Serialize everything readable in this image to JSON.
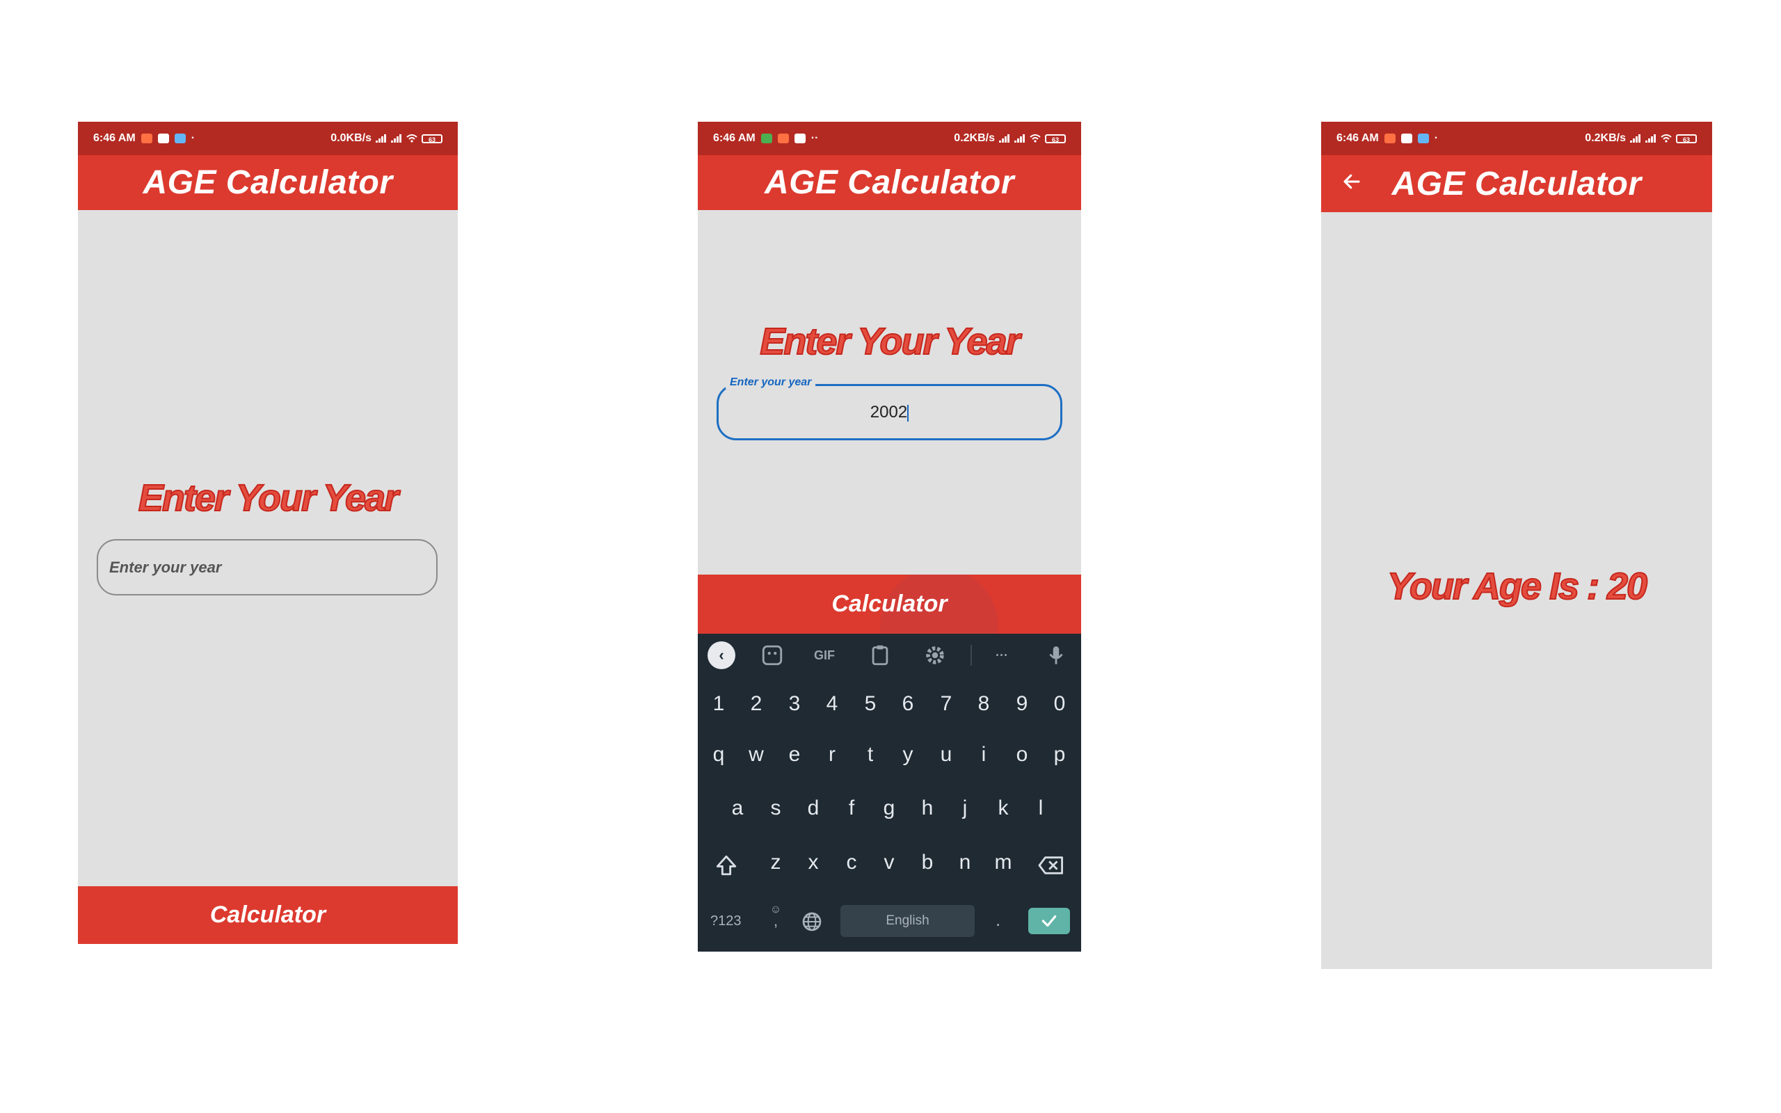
{
  "status": {
    "time": "6:46 AM",
    "dot": "·",
    "dots2": "··",
    "speed_1": "0.0KB/s",
    "speed_2": "0.2KB/s",
    "speed_3": "0.2KB/s",
    "battery": "63"
  },
  "app": {
    "title": "AGE Calculator"
  },
  "screen1": {
    "heading": "Enter Your Year",
    "input_placeholder": "Enter your year",
    "button": "Calculator"
  },
  "screen2": {
    "heading": "Enter Your Year",
    "input_label": "Enter your year",
    "input_value": "2002",
    "button": "Calculator",
    "keyboard": {
      "toolbar": [
        "chevron-left-icon",
        "sticker-icon",
        "GIF",
        "clipboard-icon",
        "gear-icon",
        "more-icon",
        "mic-icon"
      ],
      "gif_label": "GIF",
      "more_label": "···",
      "numbers": [
        "1",
        "2",
        "3",
        "4",
        "5",
        "6",
        "7",
        "8",
        "9",
        "0"
      ],
      "row1": [
        "q",
        "w",
        "e",
        "r",
        "t",
        "y",
        "u",
        "i",
        "o",
        "p"
      ],
      "row2": [
        "a",
        "s",
        "d",
        "f",
        "g",
        "h",
        "j",
        "k",
        "l"
      ],
      "row3": [
        "z",
        "x",
        "c",
        "v",
        "b",
        "n",
        "m"
      ],
      "sym_label": "?123",
      "emoji_comma": ",",
      "space_label": "English",
      "period": "."
    }
  },
  "screen3": {
    "result": "Your Age Is : 20"
  },
  "colors": {
    "accent": "#dc3a2f",
    "statusbar": "#b32a22",
    "background": "#e0e0e0",
    "focus": "#1565c0",
    "keyboard_bg": "#1f2a33",
    "enter_key": "#5fb3a7"
  }
}
